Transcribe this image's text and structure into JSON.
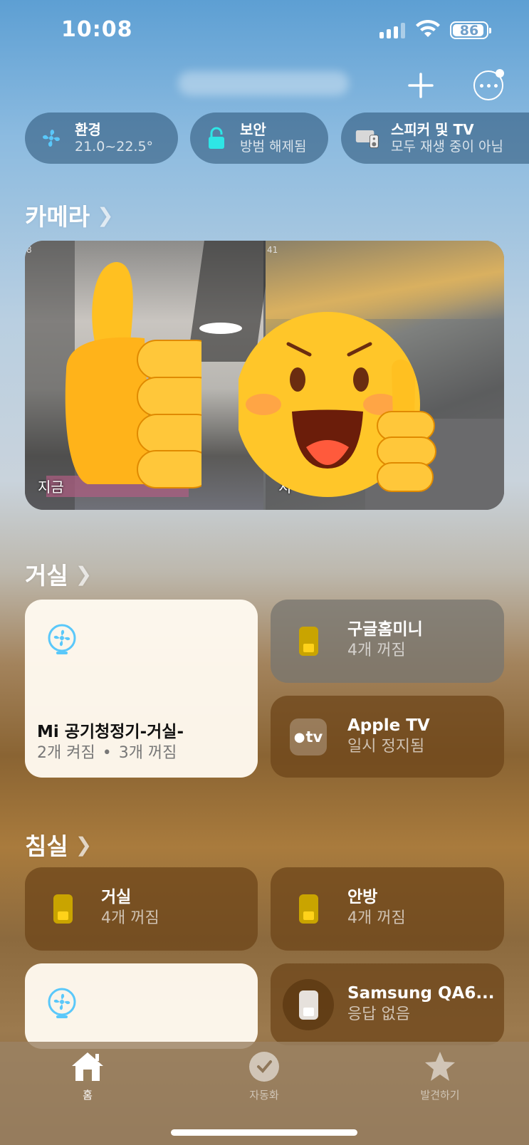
{
  "status_bar": {
    "time": "10:08",
    "battery": "86"
  },
  "header": {
    "home_name_redacted": ""
  },
  "chips": [
    {
      "title": "환경",
      "subtitle": "21.0~22.5°",
      "icon": "fan-icon"
    },
    {
      "title": "보안",
      "subtitle": "방범 해제됨",
      "icon": "lock-icon"
    },
    {
      "title": "스피커 및 TV",
      "subtitle": "모두 재생 중이 아님",
      "icon": "speaker-tv-icon"
    }
  ],
  "camera_section": {
    "title": "카메라",
    "feeds": [
      {
        "index": "8",
        "label": "지금"
      },
      {
        "index": "41",
        "label": "지"
      }
    ]
  },
  "living_room": {
    "title": "거실",
    "tiles": [
      {
        "name": "Mi 공기청정기-거실-",
        "sub_on": "2개 켜짐",
        "sep": "•",
        "sub_off": "3개 꺼짐"
      },
      {
        "name": "구글홈미니",
        "sub": "4개 꺼짐"
      },
      {
        "name": "Apple TV",
        "sub": "일시 정지됨",
        "logo": "tv"
      }
    ]
  },
  "bedroom": {
    "title": "침실",
    "tiles": [
      {
        "name": "거실",
        "sub": "4개 꺼짐"
      },
      {
        "name": "안방",
        "sub": "4개 꺼짐"
      },
      {
        "name": "Samsung QA6...",
        "sub": "응답 없음"
      }
    ]
  },
  "tabs": [
    {
      "label": "홈",
      "icon": "house-icon",
      "active": true
    },
    {
      "label": "자동화",
      "icon": "clock-icon",
      "active": false
    },
    {
      "label": "발견하기",
      "icon": "star-icon",
      "active": false
    }
  ],
  "colors": {
    "accent_fan": "#5ac8fa",
    "accent_lock": "#2ee6e6",
    "plug_on": "#ffd21a"
  }
}
